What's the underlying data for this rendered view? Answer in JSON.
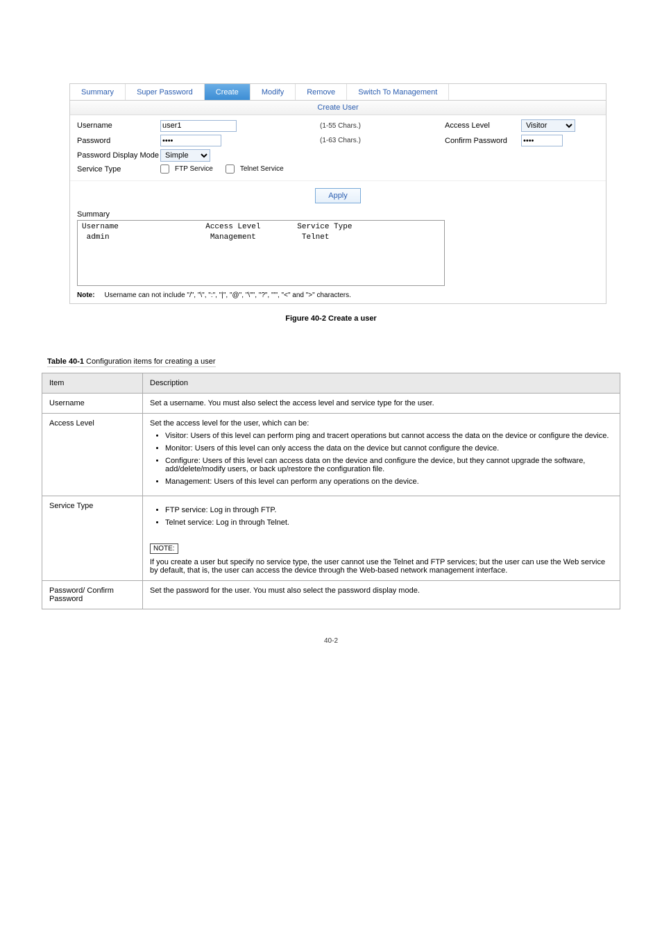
{
  "tabs": {
    "summary": "Summary",
    "super_password": "Super Password",
    "create": "Create",
    "modify": "Modify",
    "remove": "Remove",
    "switch_to_management": "Switch To Management"
  },
  "panel": {
    "title": "Create User"
  },
  "form": {
    "username_label": "Username",
    "username_value": "user1",
    "username_hint": "(1-55 Chars.)",
    "access_level_label": "Access Level",
    "access_level_value": "Visitor",
    "password_label": "Password",
    "password_value": "••••",
    "password_hint": "(1-63 Chars.)",
    "confirm_password_label": "Confirm Password",
    "confirm_password_value": "••••",
    "pdm_label": "Password Display Mode",
    "pdm_value": "Simple",
    "service_type_label": "Service Type",
    "ftp_service": "FTP Service",
    "telnet_service": "Telnet Service"
  },
  "buttons": {
    "apply": "Apply"
  },
  "summary": {
    "heading": "Summary",
    "header_line": "Username                   Access Level        Service Type",
    "row_line": " admin                      Management          Telnet"
  },
  "note": {
    "label": "Note:",
    "text": "Username can not include \"/\", \"\\\", \":\", \"|\", \"@\", \"\\\"\", \"?\", \"'\", \"<\" and \">\" characters."
  },
  "figure_caption": "Figure 40-2 Create a user",
  "table_caption_title": "Table 40-1",
  "table_caption_rest": " Configuration items for creating a user",
  "desc_table": {
    "header_item": "Item",
    "header_desc": "Description",
    "rows": [
      {
        "item": "Username",
        "desc_lines": [
          "Set a username. You must also select the access level and service type for the user."
        ]
      },
      {
        "item": "Access Level",
        "intro": "Set the access level for the user, which can be:",
        "bullets": [
          "Visitor: Users of this level can perform ping and tracert operations but cannot access the data on the device or configure the device.",
          "Monitor: Users of this level can only access the data on the device but cannot configure the device.",
          "Configure: Users of this level can access data on the device and configure the device, but they cannot upgrade the software, add/delete/modify users, or back up/restore the configuration file.",
          "Management: Users of this level can perform any operations on the device."
        ]
      },
      {
        "item": "Service Type",
        "bullets2": [
          "FTP service: Log in through FTP.",
          "Telnet service: Log in through Telnet."
        ],
        "note_hdr": "NOTE:",
        "note_body": "If you create a user but specify no service type, the user cannot use the Telnet and FTP services; but the user can use the Web service by default, that is, the user can access the device through the Web-based network management interface."
      },
      {
        "item": "Password/ Confirm Password",
        "desc_lines": [
          "Set the password for the user. You must also select the password display mode."
        ]
      }
    ]
  },
  "footer": "40-2"
}
